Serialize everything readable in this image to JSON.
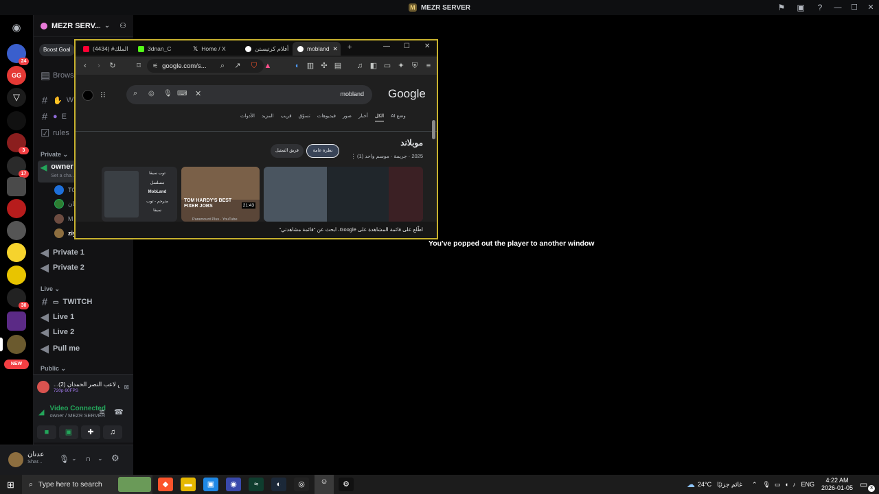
{
  "app": {
    "title": "MEZR SERVER",
    "logo_letter": "M"
  },
  "rail": {
    "badges": [
      "24",
      "3",
      "17",
      "30"
    ],
    "new_label": "NEW"
  },
  "sidebar": {
    "server_name": "MEZR SERV...",
    "boost_label": "Boost Goal",
    "browse_label": "Browse",
    "channels_top": [
      {
        "icon": "#",
        "label": "W"
      },
      {
        "icon": "#",
        "label": "E"
      },
      {
        "icon": "☑",
        "label": "rules"
      }
    ],
    "categories": {
      "private": "Private",
      "live": "Live",
      "public": "Public"
    },
    "owner_channel": {
      "label": "owner",
      "status": "Set a cha..."
    },
    "voice_users": [
      "TO",
      "عدنان",
      "M",
      "ziy"
    ],
    "private_channels": [
      "Private 1",
      "Private 2"
    ],
    "live_channels": [
      "TWITCH",
      "Live 1",
      "Live 2",
      "Pull me"
    ]
  },
  "stream": {
    "title": "...خص لاعب النصر الحمدان (2)",
    "quality": "720p 60FPS",
    "connected_label": "Video Connected",
    "connected_sub": "owner / MEZR SERVER"
  },
  "user": {
    "name": "عدنان",
    "status": "Shar..."
  },
  "browser": {
    "tabs": [
      {
        "label": "(4434) #الملك",
        "color": "#ff0033"
      },
      {
        "label": "3dnan_C",
        "color": "#53fc18"
      },
      {
        "label": "Home / X",
        "color": "#ffffff"
      },
      {
        "label": "أفلام كرتيستن",
        "color": "#4285f4"
      },
      {
        "label": "mobland",
        "color": "#4285f4"
      }
    ],
    "url": "google.com/s...",
    "search_query": "mobland",
    "google_logo": "Google",
    "nav_tabs": [
      "وضع AI",
      "الكل",
      "أخبار",
      "صور",
      "فيديوهات",
      "تسوّق",
      "قريب",
      "المزيد",
      "الأدوات"
    ],
    "kp_title": "موبلاند",
    "kp_subtitle": "2025 · جريمة · موسم واحد (1)",
    "kp_buttons": [
      "نظرة عامة",
      "فريق التمثيل"
    ],
    "video_card": {
      "title": "TOM HARDY'S BEST FIXER JOBS",
      "duration": "21:43",
      "source": "Paramount Plus · YouTube"
    },
    "left_card_lines": [
      "توب سيفا",
      "مسلسل",
      "MobLand",
      "مترجم - توب",
      "سيفا"
    ],
    "cookie_text": "اطّلع على قائمة المشاهدة على Google، ابحث عن \"قائمة مشاهدتي\""
  },
  "popout_message": "You've popped out the player to another window",
  "taskbar": {
    "search_placeholder": "Type here to search",
    "weather_temp": "24°C",
    "weather_text": "غائم جزئيًا",
    "lang": "ENG",
    "time": "4:22 AM",
    "date": "2026-01-05",
    "notif_count": "3"
  }
}
